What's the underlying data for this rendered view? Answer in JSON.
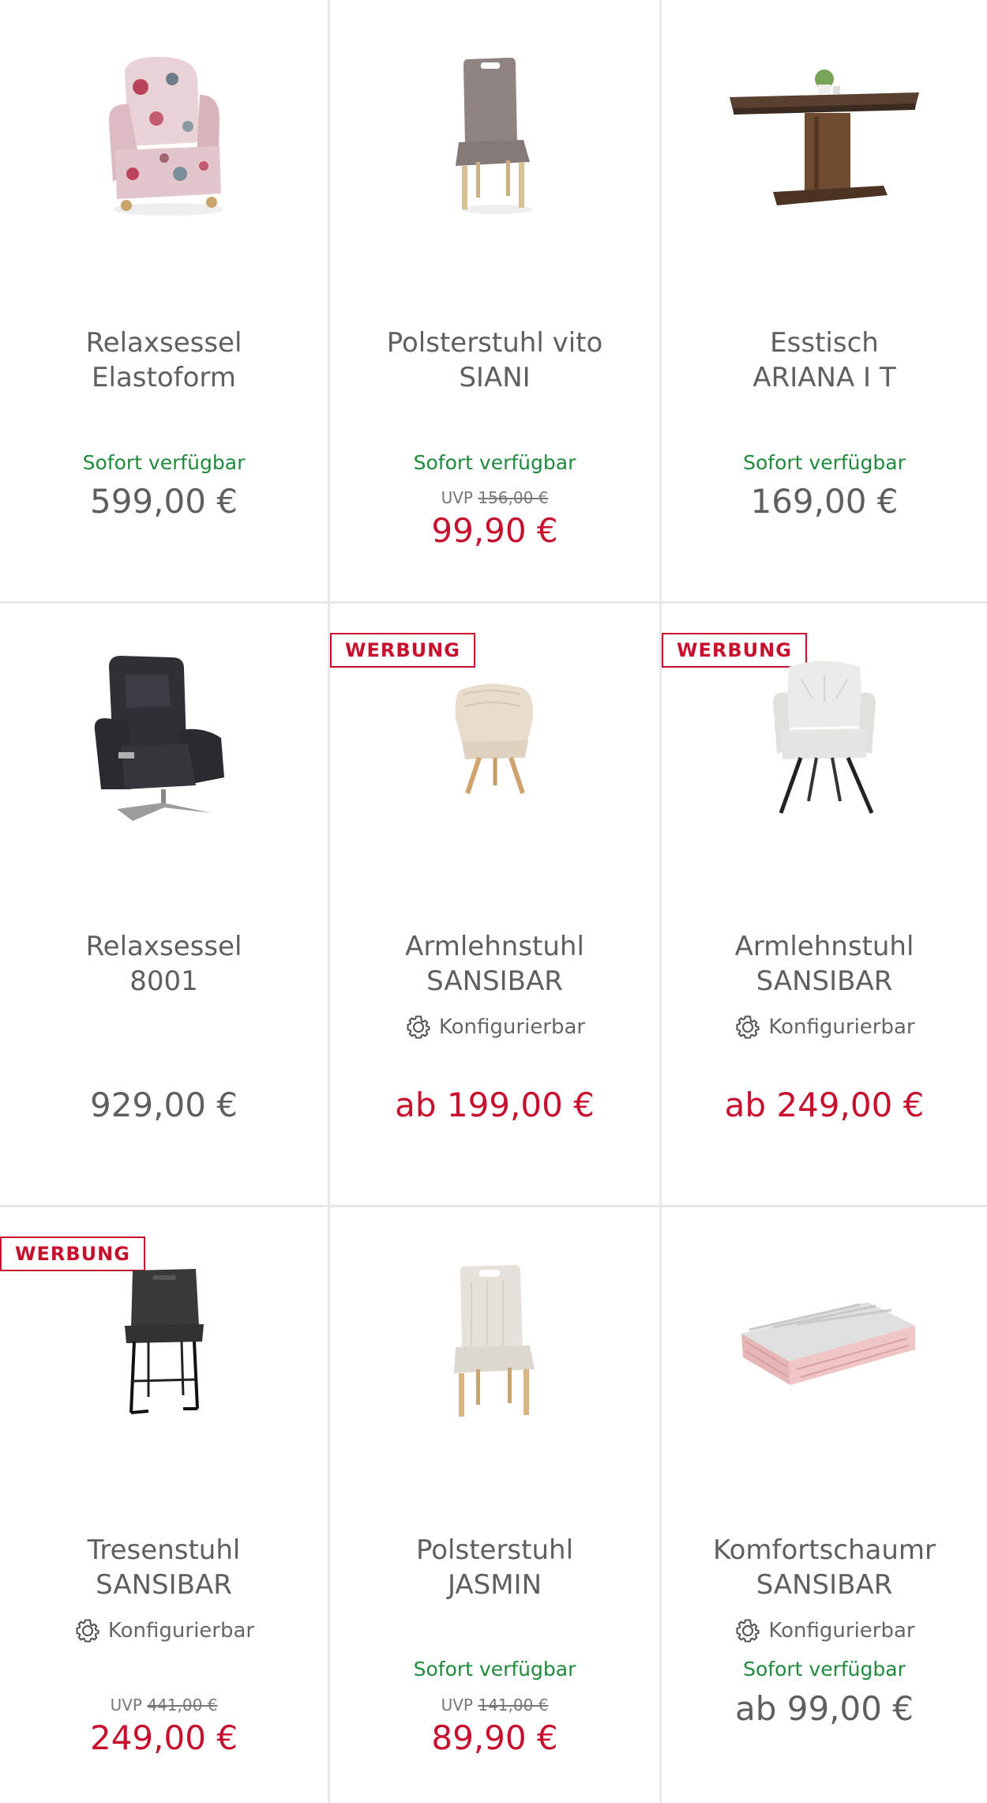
{
  "colors": {
    "sale": "#c8102e",
    "available": "#1e8a3c",
    "text": "#5f5f5f",
    "divider": "#e8e8e8"
  },
  "products": [
    {
      "title_line1": "Relaxsessel",
      "title_line2": "Elastoform",
      "badge": "",
      "configurable": "",
      "availability": "Sofort verfügbar",
      "uvp_label": "",
      "uvp_price": "",
      "price": "599,00 €",
      "sale": false,
      "image": "floral-armchair"
    },
    {
      "title_line1": "Polsterstuhl vito",
      "title_line2": "SIANI",
      "badge": "",
      "configurable": "",
      "availability": "Sofort verfügbar",
      "uvp_label": "UVP",
      "uvp_price": "156,00 €",
      "price": "99,90 €",
      "sale": true,
      "image": "taupe-chair"
    },
    {
      "title_line1": "Esstisch",
      "title_line2": "ARIANA I T",
      "badge": "",
      "configurable": "",
      "availability": "Sofort verfügbar",
      "uvp_label": "",
      "uvp_price": "",
      "price": "169,00 €",
      "sale": false,
      "image": "dining-table"
    },
    {
      "title_line1": "Relaxsessel",
      "title_line2": "8001",
      "badge": "",
      "configurable": "",
      "availability": "",
      "uvp_label": "",
      "uvp_price": "",
      "price": "929,00 €",
      "sale": false,
      "image": "recliner"
    },
    {
      "title_line1": "Armlehnstuhl",
      "title_line2": "SANSIBAR",
      "badge": "WERBUNG",
      "configurable": "Konfigurierbar",
      "availability": "",
      "uvp_label": "",
      "uvp_price": "",
      "price": "ab 199,00 €",
      "sale": true,
      "image": "beige-armchair-wood"
    },
    {
      "title_line1": "Armlehnstuhl",
      "title_line2": "SANSIBAR",
      "badge": "WERBUNG",
      "configurable": "Konfigurierbar",
      "availability": "",
      "uvp_label": "",
      "uvp_price": "",
      "price": "ab 249,00 €",
      "sale": true,
      "image": "white-armchair-metal"
    },
    {
      "title_line1": "Tresenstuhl",
      "title_line2": "SANSIBAR",
      "badge": "WERBUNG",
      "configurable": "Konfigurierbar",
      "availability": "",
      "uvp_label": "UVP",
      "uvp_price": "441,00 €",
      "price": "249,00 €",
      "sale": true,
      "image": "bar-stool"
    },
    {
      "title_line1": "Polsterstuhl",
      "title_line2": "JASMIN",
      "badge": "",
      "configurable": "",
      "availability": "Sofort verfügbar",
      "uvp_label": "UVP",
      "uvp_price": "141,00 €",
      "price": "89,90 €",
      "sale": true,
      "image": "cream-chair"
    },
    {
      "title_line1": "Komfortschaumr",
      "title_line2": "SANSIBAR",
      "badge": "",
      "configurable": "Konfigurierbar",
      "availability": "Sofort verfügbar",
      "uvp_label": "",
      "uvp_price": "",
      "price": "ab 99,00 €",
      "sale": false,
      "image": "foam-mattress"
    }
  ]
}
